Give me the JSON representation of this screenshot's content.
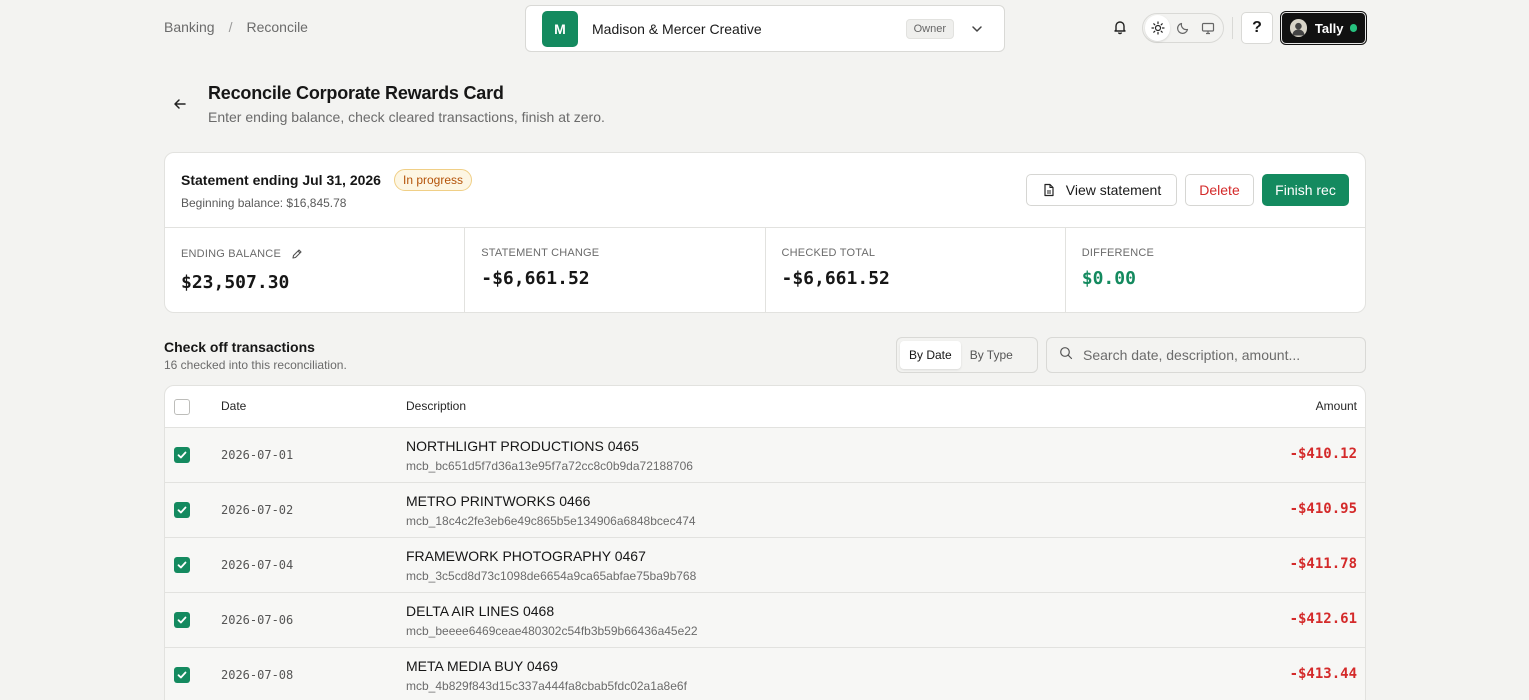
{
  "breadcrumb": {
    "items": [
      "Banking",
      "Reconcile"
    ],
    "separator": "/"
  },
  "org": {
    "initial": "M",
    "name": "Madison & Mercer Creative",
    "role": "Owner"
  },
  "user": {
    "name": "Tally"
  },
  "page": {
    "title": "Reconcile Corporate Rewards Card",
    "subtitle": "Enter ending balance, check cleared transactions, finish at zero."
  },
  "statement": {
    "title": "Statement ending Jul 31, 2026",
    "status": "In progress",
    "beginning_balance": "Beginning balance: $16,845.78",
    "view_label": "View statement",
    "delete_label": "Delete",
    "finish_label": "Finish rec"
  },
  "metrics": {
    "ending_balance": {
      "label": "ENDING BALANCE",
      "value": "$23,507.30"
    },
    "statement_change": {
      "label": "STATEMENT CHANGE",
      "value": "-$6,661.52"
    },
    "checked_total": {
      "label": "CHECKED TOTAL",
      "value": "-$6,661.52"
    },
    "difference": {
      "label": "DIFFERENCE",
      "value": "$0.00"
    }
  },
  "transactions": {
    "title": "Check off transactions",
    "subtitle": "16 checked into this reconciliation.",
    "view_tabs": [
      "By Date",
      "By Type"
    ],
    "search_placeholder": "Search date, description, amount...",
    "columns": {
      "date": "Date",
      "description": "Description",
      "amount": "Amount"
    },
    "rows": [
      {
        "date": "2026-07-01",
        "description": "NORTHLIGHT PRODUCTIONS 0465",
        "id": "mcb_bc651d5f7d36a13e95f7a72cc8c0b9da72188706",
        "amount": "-$410.12"
      },
      {
        "date": "2026-07-02",
        "description": "METRO PRINTWORKS 0466",
        "id": "mcb_18c4c2fe3eb6e49c865b5e134906a6848bcec474",
        "amount": "-$410.95"
      },
      {
        "date": "2026-07-04",
        "description": "FRAMEWORK PHOTOGRAPHY 0467",
        "id": "mcb_3c5cd8d73c1098de6654a9ca65abfae75ba9b768",
        "amount": "-$411.78"
      },
      {
        "date": "2026-07-06",
        "description": "DELTA AIR LINES 0468",
        "id": "mcb_beeee6469ceae480302c54fb3b59b66436a45e22",
        "amount": "-$412.61"
      },
      {
        "date": "2026-07-08",
        "description": "META MEDIA BUY 0469",
        "id": "mcb_4b829f843d15c337a444fa8cbab5fdc02a1a8e6f",
        "amount": "-$413.44"
      }
    ]
  },
  "colors": {
    "accent": "#148a5f",
    "danger": "#d42a2a",
    "warning": "#b45309"
  }
}
